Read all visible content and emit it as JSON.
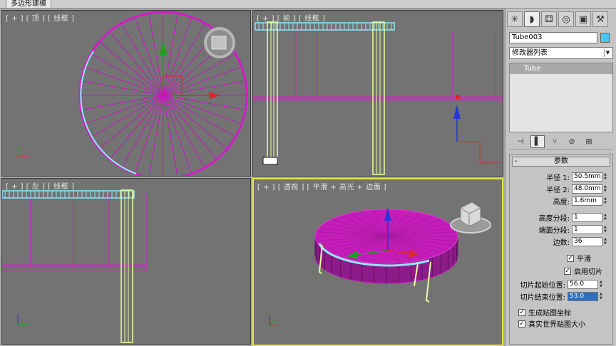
{
  "ribbon": {
    "tab_label": "多边形建模"
  },
  "viewports": {
    "top_label": "[ + ] [ 顶 ] [ 线框 ]",
    "front_label": "[ + ] [ 前 ] [ 线框 ]",
    "left_label": "[ + ] [ 左 ] [ 线框 ]",
    "perspective_label": "[ + ] [ 透视 ] [ 平滑 + 高光 + 边面 ]",
    "gizmo_x": "x",
    "gizmo_y": "y",
    "gizmo_z": "z"
  },
  "panel": {
    "tabs": [
      {
        "icon": "create-icon",
        "glyph": "✳"
      },
      {
        "icon": "modify-icon",
        "glyph": "◗"
      },
      {
        "icon": "hierarchy-icon",
        "glyph": "⚃"
      },
      {
        "icon": "motion-icon",
        "glyph": "◎"
      },
      {
        "icon": "display-icon",
        "glyph": "▣"
      },
      {
        "icon": "utilities-icon",
        "glyph": "⚒"
      }
    ],
    "object_name": "Tube003",
    "object_color": "#4fc3ef",
    "modifier_list": "修改器列表",
    "stack": [
      "Tube"
    ],
    "parameters": {
      "title": "参数",
      "radius1_label": "半径 1:",
      "radius1_value": "50.5mm",
      "radius2_label": "半径 2:",
      "radius2_value": "48.0mm",
      "height_label": "高度:",
      "height_value": "1.6mm",
      "height_segs_label": "高度分段:",
      "height_segs_value": "1",
      "cap_segs_label": "端面分段:",
      "cap_segs_value": "1",
      "sides_label": "边数:",
      "sides_value": "36",
      "smooth_label": "平滑",
      "smooth_checked": true,
      "slice_on_label": "启用切片",
      "slice_on_checked": true,
      "slice_from_label": "切片起始位置:",
      "slice_from_value": "56.0",
      "slice_to_label": "切片结束位置:",
      "slice_to_value": "53.0",
      "gen_map_label": "生成贴图坐标",
      "gen_map_checked": true,
      "real_world_label": "真实世界贴图大小",
      "real_world_checked": true
    }
  },
  "colors": {
    "viewport_bg": "#737373",
    "wire_magenta": "#d21cc8",
    "selected_cyan": "#8fe8ff",
    "legs_yellow_green": "#e7ff9c",
    "active_border": "#e6e04a"
  }
}
